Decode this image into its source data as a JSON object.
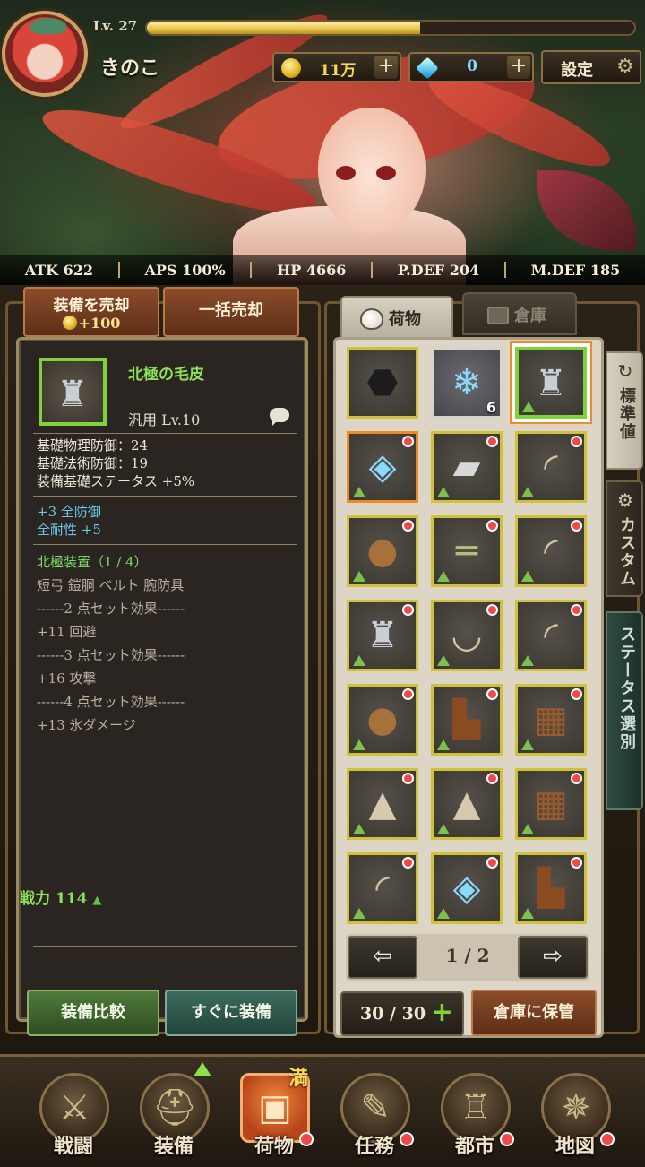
{
  "header": {
    "level": "Lv. 27",
    "exp_progress": 0.56,
    "player_name": "きのこ",
    "gold": "11万",
    "gems": "0",
    "plus": "+",
    "settings_label": "設定"
  },
  "stats": [
    {
      "label": "ATK 622"
    },
    {
      "label": "APS 100%"
    },
    {
      "label": "HP 4666"
    },
    {
      "label": "P.DEF 204"
    },
    {
      "label": "M.DEF 185"
    }
  ],
  "actions": {
    "sell_label": "装備を売却",
    "sell_amount": "+100",
    "bulk_sell_label": "一括売却",
    "compare_label": "装備比較",
    "equip_now_label": "すぐに装備"
  },
  "item": {
    "name": "北極の毛皮",
    "category": "汎用 Lv.10",
    "base_lines": [
      "基礎物理防御：24",
      "基礎法術防御：19",
      "装備基礎ステータス +5%"
    ],
    "bonus_lines": [
      "+3 全防御",
      "全耐性 +5"
    ],
    "set_name": "北極装置（1 / 4）",
    "set_members": "短弓 鎧胴 ベルト 腕防具",
    "set_effects": [
      "------2 点セット効果------",
      "+11 回避",
      "------3 点セット効果------",
      "+16 攻撃",
      "------4 点セット効果------",
      "+13 氷ダメージ"
    ],
    "power": "戦力 114"
  },
  "tabs": {
    "items": "荷物",
    "storage": "倉庫"
  },
  "side_tabs": {
    "standard": "標準値",
    "custom": "カスタム",
    "status": "ステータス選別"
  },
  "inventory": {
    "slots": [
      {
        "icon": "coal-icon",
        "qty": ""
      },
      {
        "icon": "ice-crystal-icon",
        "qty": "6"
      },
      {
        "icon": "fur-armor-icon",
        "qty": ""
      },
      {
        "icon": "amulet-icon",
        "qty": ""
      },
      {
        "icon": "bracer-icon",
        "qty": ""
      },
      {
        "icon": "bow-icon",
        "qty": ""
      },
      {
        "icon": "shield-icon",
        "qty": ""
      },
      {
        "icon": "belt-icon",
        "qty": ""
      },
      {
        "icon": "bow-icon",
        "qty": ""
      },
      {
        "icon": "armor-icon",
        "qty": ""
      },
      {
        "icon": "bow-icon",
        "qty": ""
      },
      {
        "icon": "bow-icon",
        "qty": ""
      },
      {
        "icon": "shield-icon",
        "qty": ""
      },
      {
        "icon": "boots-icon",
        "qty": ""
      },
      {
        "icon": "gauntlet-icon",
        "qty": ""
      },
      {
        "icon": "wizard-hat-icon",
        "qty": ""
      },
      {
        "icon": "wizard-hat-icon",
        "qty": ""
      },
      {
        "icon": "gauntlet-icon",
        "qty": ""
      },
      {
        "icon": "bow-icon",
        "qty": ""
      },
      {
        "icon": "amulet-icon",
        "qty": ""
      },
      {
        "icon": "boots-icon",
        "qty": ""
      }
    ],
    "page": "1 / 2",
    "capacity": "30 / 30",
    "store_label": "倉庫に保管"
  },
  "nav": {
    "battle": "戦闘",
    "equipment": "装備",
    "items": "荷物",
    "items_badge": "満",
    "quests": "任務",
    "city": "都市",
    "map": "地図"
  }
}
